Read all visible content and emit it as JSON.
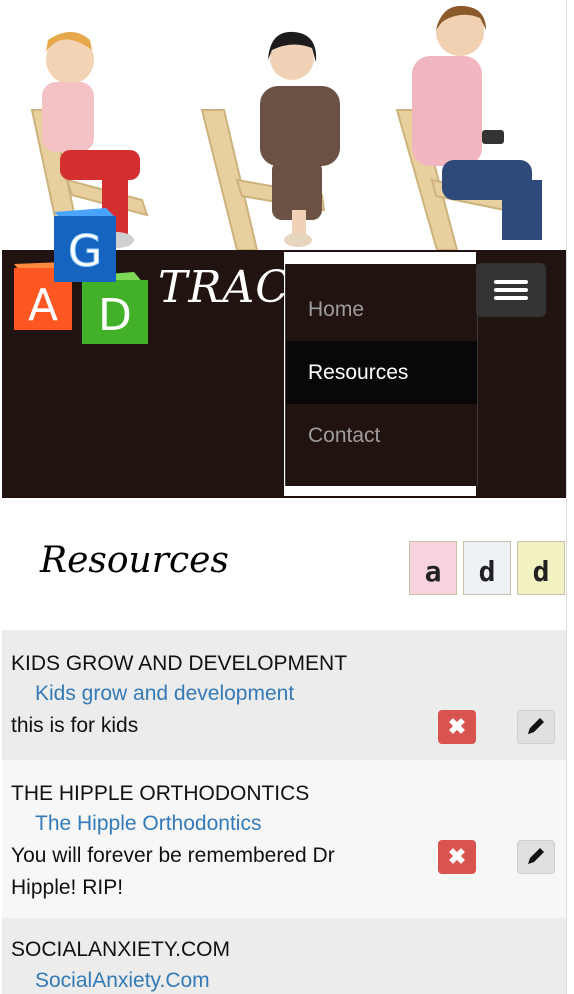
{
  "brand": {
    "logo_letters": [
      "G",
      "A",
      "D"
    ],
    "logo_text": "TRAC"
  },
  "nav": {
    "items": [
      {
        "label": "Home",
        "active": false
      },
      {
        "label": "Resources",
        "active": true
      },
      {
        "label": "Contact",
        "active": false
      }
    ]
  },
  "page": {
    "title": "Resources",
    "add_block_letters": [
      "a",
      "d",
      "d"
    ]
  },
  "resources": [
    {
      "title": "KIDS GROW AND DEVELOPMENT",
      "link": "Kids grow and development",
      "description": "this is for kids"
    },
    {
      "title": "THE HIPPLE ORTHODONTICS",
      "link": "The Hipple Orthodontics",
      "description": "You will forever be remembered Dr Hipple! RIP!"
    },
    {
      "title": "SOCIALANXIETY.COM",
      "link": "SocialAnxiety.Com",
      "description": ""
    }
  ],
  "colors": {
    "navbar": "#21130f",
    "link": "#337ab7",
    "delete": "#d9534f"
  }
}
